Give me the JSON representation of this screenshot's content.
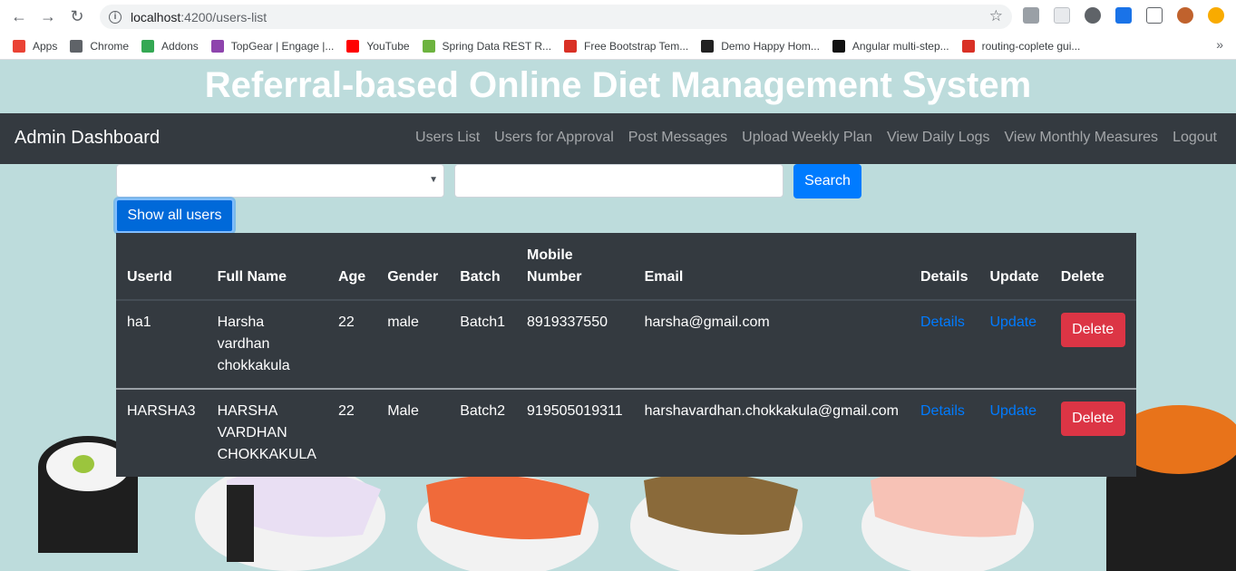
{
  "browser": {
    "url_host": "localhost",
    "url_rest": ":4200/users-list",
    "bookmarks": [
      {
        "label": "Apps",
        "color": "#ea4335"
      },
      {
        "label": "Chrome",
        "color": "#5f6368"
      },
      {
        "label": "Addons",
        "color": "#34a853"
      },
      {
        "label": "TopGear | Engage |...",
        "color": "#8e44ad"
      },
      {
        "label": "YouTube",
        "color": "#ff0000"
      },
      {
        "label": "Spring Data REST R...",
        "color": "#6db33f"
      },
      {
        "label": "Free Bootstrap Tem...",
        "color": "#d93025"
      },
      {
        "label": "Demo Happy Hom...",
        "color": "#222222"
      },
      {
        "label": "Angular multi-step...",
        "color": "#111111"
      },
      {
        "label": "routing-coplete gui...",
        "color": "#d93025"
      }
    ],
    "more": "»"
  },
  "page": {
    "title": "Referral-based Online Diet Management System"
  },
  "navbar": {
    "brand": "Admin Dashboard",
    "links": [
      "Users List",
      "Users for Approval",
      "Post Messages",
      "Upload Weekly Plan",
      "View Daily Logs",
      "View Monthly Measures",
      "Logout"
    ]
  },
  "search": {
    "button": "Search",
    "show_all": "Show all users"
  },
  "table": {
    "headers": [
      "UserId",
      "Full Name",
      "Age",
      "Gender",
      "Batch",
      "Mobile Number",
      "Email",
      "Details",
      "Update",
      "Delete"
    ],
    "rows": [
      {
        "userid": "ha1",
        "fullname": "Harsha vardhan chokkakula",
        "age": "22",
        "gender": "male",
        "batch": "Batch1",
        "mobile": "8919337550",
        "email": "harsha@gmail.com",
        "details": "Details",
        "update": "Update",
        "delete": "Delete"
      },
      {
        "userid": "HARSHA3",
        "fullname": "HARSHA VARDHAN CHOKKAKULA",
        "age": "22",
        "gender": "Male",
        "batch": "Batch2",
        "mobile": "919505019311",
        "email": "harshavardhan.chokkakula@gmail.com",
        "details": "Details",
        "update": "Update",
        "delete": "Delete"
      }
    ]
  },
  "colors": {
    "navbar": "#343a40",
    "primary": "#007bff",
    "danger": "#dc3545",
    "background": "#bddcdc"
  }
}
